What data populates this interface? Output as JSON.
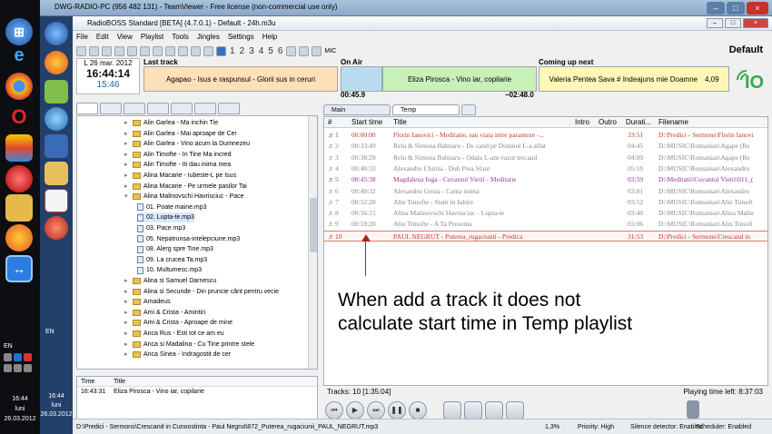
{
  "tv_title": "DWG-RADIO-PC (956 482 131) - TeamViewer - Free license (non-commercial use only)",
  "rb_title": "RadioBOSS Standard [BETA] (4.7.0.1) - Default - 24h.m3u",
  "menu": [
    "File",
    "Edit",
    "View",
    "Playlist",
    "Tools",
    "Jingles",
    "Settings",
    "Help"
  ],
  "toolbar_numbers": [
    "1",
    "2",
    "3",
    "4",
    "5",
    "6"
  ],
  "mic_label": "MIC",
  "profile": "Default",
  "clock": {
    "date": "L 26 mar. 2012",
    "time": "16:44:14",
    "time2": "15:46"
  },
  "last_track": {
    "label": "Last track",
    "value": "Agapao - Isus e raspunsul - Glorii sus in ceruri"
  },
  "on_air": {
    "label": "On Air",
    "value": "Eliza Pirosca - Vino iar, copilarie",
    "elapsed": "00:45.9",
    "remaining": "−02:48.0",
    "progress": 0.46
  },
  "coming_up": {
    "label": "Coming up next",
    "value": "Valeria Pentea Sava # Indeajuns mie Doamne",
    "duration": "4,09"
  },
  "logo_text": "IO",
  "tree": [
    {
      "type": "folder",
      "label": "Alin Garlea - Ma inchin Tie"
    },
    {
      "type": "folder",
      "label": "Alin Garlea - Mai aproape de Cer"
    },
    {
      "type": "folder",
      "label": "Alin Garlea - Vino acum la Dumnezeu"
    },
    {
      "type": "folder",
      "label": "Alin Timofte - In Tine Ma incred"
    },
    {
      "type": "folder",
      "label": "Alin Timofte - Iti dau inima mea"
    },
    {
      "type": "folder",
      "label": "Alina Macarie - Iubeste-L pe Isus"
    },
    {
      "type": "folder",
      "label": "Alina Macarie - Pe urmele pasilor Tai"
    },
    {
      "type": "folder",
      "label": "Alina Malinovschi Havrisciuc - Pace",
      "open": true
    },
    {
      "type": "file",
      "label": "01. Poate maine.mp3"
    },
    {
      "type": "file",
      "label": "02. Lupta-te.mp3",
      "selected": true
    },
    {
      "type": "file",
      "label": "03. Pace.mp3"
    },
    {
      "type": "file",
      "label": "05. Nepatrunsa-intelepciune.mp3"
    },
    {
      "type": "file",
      "label": "08. Alerg spre Tine.mp3"
    },
    {
      "type": "file",
      "label": "09. La crucea Ta.mp3"
    },
    {
      "type": "file",
      "label": "10. Multumesc.mp3"
    },
    {
      "type": "folder",
      "label": "Alina si Samuel Darnescu"
    },
    {
      "type": "folder",
      "label": "Alina si Secunde - Din pruncie cânt pentru vecie"
    },
    {
      "type": "folder",
      "label": "Amadeus"
    },
    {
      "type": "folder",
      "label": "Ami & Crista - Amintiri"
    },
    {
      "type": "folder",
      "label": "Ami & Crista - Aproape de mine"
    },
    {
      "type": "folder",
      "label": "Anca Rus - Esti tot ce am eu"
    },
    {
      "type": "folder",
      "label": "Anca si Madalina - Cu Tine printre stele"
    },
    {
      "type": "folder",
      "label": "Anca Sinea - Indragostit de cer"
    }
  ],
  "history": {
    "headers": [
      "Time",
      "Title"
    ],
    "rows": [
      {
        "time": "16:43:31",
        "title": "Eliza Pirosca - Vino iar, copilarie"
      }
    ]
  },
  "playlist_tabs": [
    "Main",
    "Temp"
  ],
  "playlist_headers": [
    "#",
    "Start time",
    "Title",
    "Intro",
    "Outro",
    "Durati...",
    "Filename"
  ],
  "playlist": [
    {
      "n": "1",
      "start": "00:00:00",
      "title": "Florin Ianovici - Meditatie, sau viata intre paranteze -...",
      "dur": "33:51",
      "file": "D:\\Predici - Sermons\\Florin Ianovi",
      "style": "hl"
    },
    {
      "n": "2",
      "start": "00:33:49",
      "title": "Relu & Simona Bahnaru - De cand pe Domnul L-a aflat",
      "dur": "04:45",
      "file": "D:\\MUSIC\\Romanian\\Agape (Re",
      "style": ""
    },
    {
      "n": "3",
      "start": "00:38:29",
      "title": "Relu & Simona Bahnaru - Odata L-am vazut trecand",
      "dur": "04:09",
      "file": "D:\\MUSIC\\Romanian\\Agape (Re",
      "style": ""
    },
    {
      "n": "4",
      "start": "00:40:33",
      "title": "Alexandru Chirita - Duh Prea Sfant",
      "dur": "05:10",
      "file": "D:\\MUSIC\\Romanian\\Alexandru",
      "style": ""
    },
    {
      "n": "5",
      "start": "00:45:38",
      "title": "Magdalena Iuga - Cuvantul Vietii - Meditatie",
      "dur": "03:59",
      "file": "D:\\Meditatii\\Cuvantul Vietii\\011_(",
      "style": "mag"
    },
    {
      "n": "6",
      "start": "00:49:32",
      "title": "Alexandru Groza - Canta inima",
      "dur": "03:01",
      "file": "D:\\MUSIC\\Romanian\\Alexandru",
      "style": ""
    },
    {
      "n": "7",
      "start": "00:52:28",
      "title": "Alin Timofte - Stam in Iubire",
      "dur": "03:52",
      "file": "D:\\MUSIC\\Romanian\\Alin Timoft",
      "style": ""
    },
    {
      "n": "8",
      "start": "00:56:15",
      "title": "Alina Malinovschi Havrisciuc - Lupta-te",
      "dur": "03:40",
      "file": "D:\\MUSIC\\Romanian\\Alina Malin",
      "style": ""
    },
    {
      "n": "9",
      "start": "00:59:28",
      "title": "Alin Timofte - A Ta Prezenta",
      "dur": "03:06",
      "file": "D:\\MUSIC\\Romanian\\Alin Timoft",
      "style": ""
    },
    {
      "n": "10",
      "start": "",
      "title": "PAUL NEGRUT - Puterea_rugaciunii - Predica",
      "dur": "31:53",
      "file": "D:\\Predici - Sermons\\Crescand in",
      "style": "hl sel"
    }
  ],
  "annotation": [
    "When add a track it does not",
    "calculate start time in Temp playlist"
  ],
  "tracks_status": "Tracks: 10 [1:35:04]",
  "time_left": "Playing time left: 8:37:03",
  "statusbar": {
    "path": "D:\\Predici - Sermons\\Crescand in Cunoostinta - Paul Negrut\\872_Puterea_rugaciunii_PAUL_NEGRUT.mp3",
    "cpu": "1,3%",
    "priority": "Priority: High",
    "silence": "Silence detector: Enabled",
    "scheduler": "Scheduler: Enabled"
  },
  "tray": {
    "lang": "EN",
    "time": "16:44",
    "day": "luni",
    "date": "26.03.2012"
  },
  "tv_side_clock": {
    "lang": "EN",
    "time": "16:44",
    "day": "luni",
    "date": "26.03.2012"
  }
}
